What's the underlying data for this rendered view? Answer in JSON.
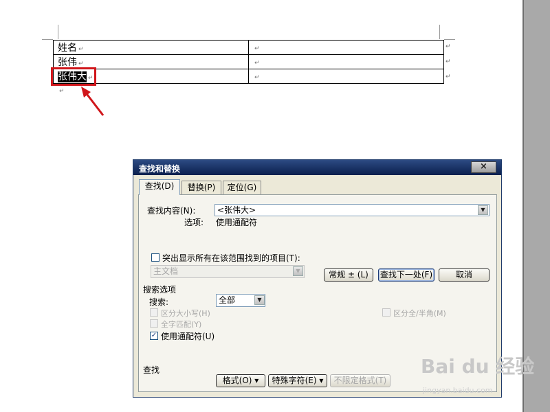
{
  "document": {
    "table": [
      [
        "姓名",
        ""
      ],
      [
        "张伟",
        ""
      ],
      [
        "张伟大",
        ""
      ]
    ],
    "paragraph_mark": "↵"
  },
  "dialog": {
    "title": "查找和替换",
    "close_label": "×",
    "tabs": [
      {
        "label": "查找(D)",
        "active": true
      },
      {
        "label": "替换(P)",
        "active": false
      },
      {
        "label": "定位(G)",
        "active": false
      }
    ],
    "find_label": "查找内容(N):",
    "find_value": "<张伟大>",
    "options_label": "选项:",
    "options_value": "使用通配符",
    "highlight_checkbox_label": "突出显示所有在该范围找到的项目(T):",
    "highlight_checked": false,
    "scope_value": "主文档",
    "buttons": {
      "normal": "常规 ± (L)",
      "find_next": "查找下一处(F)",
      "cancel": "取消"
    },
    "search_options_heading": "搜索选项",
    "search_label": "搜索:",
    "search_value": "全部",
    "checkboxes": [
      {
        "label": "区分大小写(H)",
        "checked": false,
        "enabled": false
      },
      {
        "label": "全字匹配(Y)",
        "checked": false,
        "enabled": false
      },
      {
        "label": "使用通配符(U)",
        "checked": true,
        "enabled": true
      }
    ],
    "halfwidth_label": "区分全/半角(M)",
    "halfwidth_checked": false,
    "find_section_label": "查找",
    "bottom_buttons": {
      "format": "格式(O) ▾",
      "special": "特殊字符(E) ▾",
      "no_format": "不限定格式(T)"
    }
  },
  "watermark": {
    "logo": "Bai du 经验",
    "url": "jingyan.baidu.com"
  },
  "colors": {
    "titlebar": "#0b1f4d",
    "highlight_box": "#d0161b",
    "dialog_bg": "#ece9d8"
  }
}
